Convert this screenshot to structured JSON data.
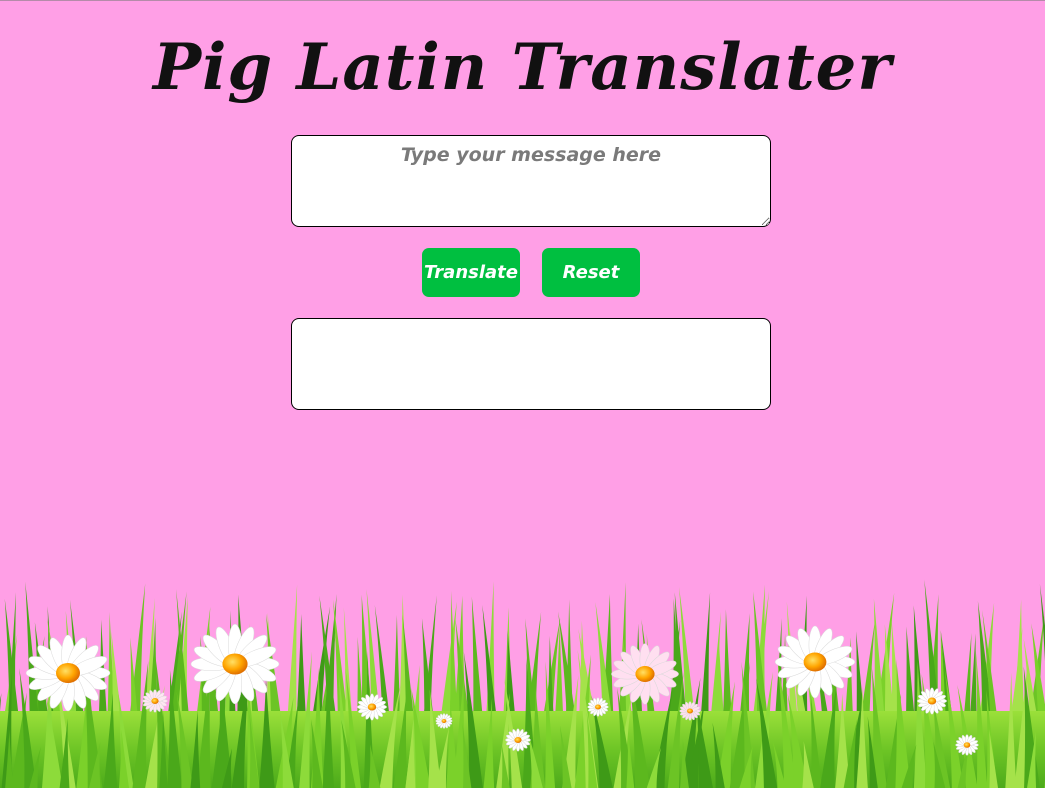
{
  "page": {
    "title": "Pig Latin Translater"
  },
  "input": {
    "placeholder": "Type your message here",
    "value": ""
  },
  "buttons": {
    "translate_label": "Translate",
    "reset_label": "Reset"
  },
  "output": {
    "text": ""
  },
  "colors": {
    "background": "#ff9fe6",
    "button": "#00bf40",
    "grass_light": "#7bd12a",
    "grass_dark": "#3e9a17"
  }
}
